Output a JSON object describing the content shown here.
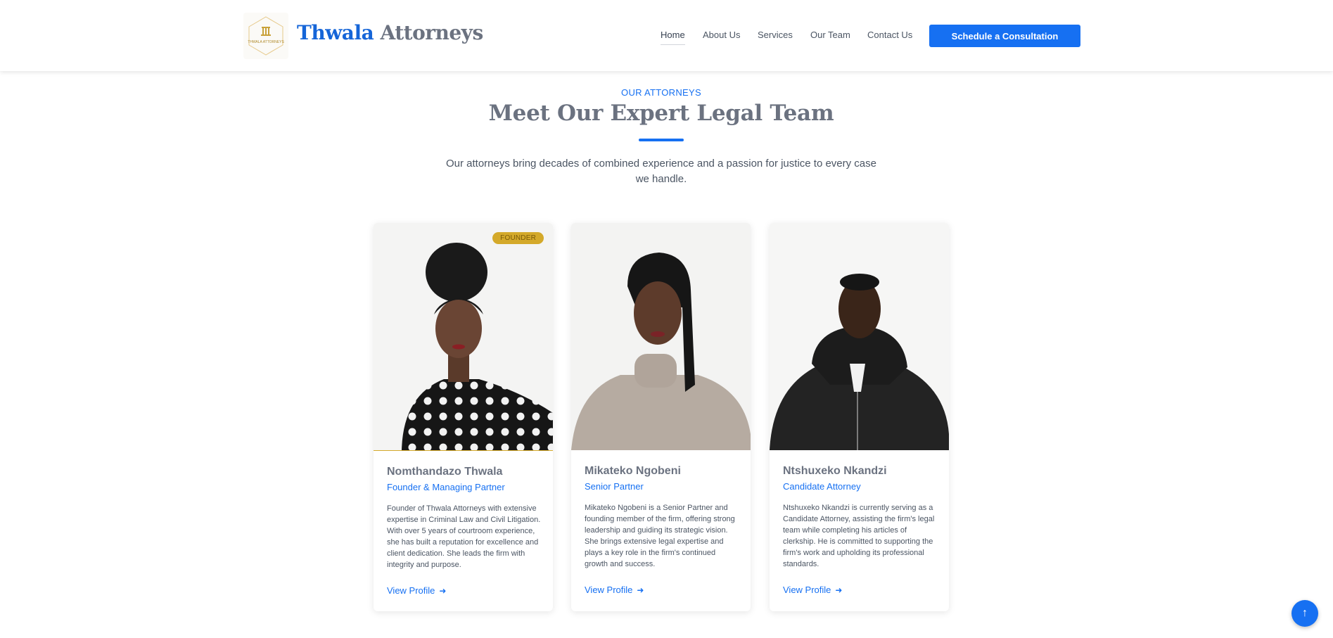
{
  "header": {
    "logo_text": "THWALA ATTORNEYS",
    "brand_first": "Thwala",
    "brand_second": "Attorneys",
    "nav": [
      "Home",
      "About Us",
      "Services",
      "Our Team",
      "Contact Us"
    ],
    "cta_label": "Schedule a Consultation"
  },
  "section": {
    "eyebrow": "OUR ATTORNEYS",
    "title": "Meet Our Expert Legal Team",
    "subtitle": "Our attorneys bring decades of combined experience and a passion for justice to every case we handle."
  },
  "team": [
    {
      "badge": "FOUNDER",
      "name": "Nomthandazo Thwala",
      "role": "Founder & Managing Partner",
      "bio": "Founder of Thwala Attorneys with extensive expertise in Criminal Law and Civil Litigation. With over 5 years of courtroom experience, she has built a reputation for excellence and client dedication. She leads the firm with integrity and purpose.",
      "link": "View Profile"
    },
    {
      "name": "Mikateko Ngobeni",
      "role": "Senior Partner",
      "bio": "Mikateko Ngobeni is a Senior Partner and founding member of the firm, offering strong leadership and guiding its strategic vision. She brings extensive legal expertise and plays a key role in the firm's continued growth and success.",
      "link": "View Profile"
    },
    {
      "name": "Ntshuxeko Nkandzi",
      "role": "Candidate Attorney",
      "bio": "Ntshuxeko Nkandzi is currently serving as a Candidate Attorney, assisting the firm's legal team while completing his articles of clerkship. He is committed to supporting the firm's work and upholding its professional standards.",
      "link": "View Profile"
    }
  ],
  "icons": {
    "logo": "scales-logo-icon",
    "arrow": "arrow-right-icon",
    "scroll_top": "arrow-up-icon"
  },
  "colors": {
    "accent": "#1670f2",
    "gold": "#d4a92a"
  }
}
